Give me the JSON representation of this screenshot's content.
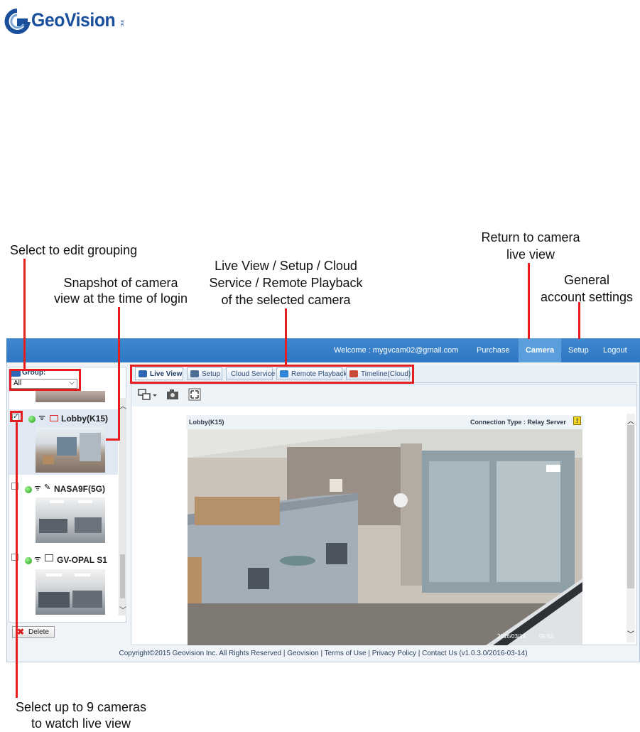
{
  "logo": {
    "text": "GeoVision",
    "suffix": "inc."
  },
  "annotations": {
    "grouping": "Select to edit grouping",
    "snapshot_l1": "Snapshot of camera",
    "snapshot_l2": "view at the time of login",
    "tabs_l1": "Live View / Setup / Cloud",
    "tabs_l2": "Service / Remote Playback",
    "tabs_l3": "of the selected camera",
    "camera_l1": "Return to camera",
    "camera_l2": "live view",
    "setup_l1": "General",
    "setup_l2": "account settings",
    "select_l1": "Select up to 9 cameras",
    "select_l2": "to watch live view"
  },
  "header": {
    "welcome": "Welcome : mygvcam02@gmail.com",
    "nav": [
      "Purchase",
      "Camera",
      "Setup",
      "Logout"
    ],
    "active": "Camera"
  },
  "sidebar": {
    "group_label": "Group:",
    "group_value": "All",
    "cameras": [
      {
        "name": "Lobby(K15)",
        "checked": true
      },
      {
        "name": "NASA9F(5G)",
        "checked": false
      },
      {
        "name": "GV-OPAL S1",
        "checked": false
      }
    ],
    "delete_label": "Delete"
  },
  "tabs": [
    "Live View",
    "Setup",
    "Cloud Service",
    "Remote Playback",
    "Timeline(Cloud)"
  ],
  "active_tab": "Live View",
  "viewer": {
    "camera_name": "Lobby(K15)",
    "connection": "Connection Type : Relay Server",
    "timestamp": "2016/03/14",
    "time": "05:53"
  },
  "footer": "Copyright©2015 Geovision Inc. All Rights Reserved | Geovision | Terms of Use | Privacy Policy | Contact Us (v1.0.3.0/2016-03-14)",
  "colors": {
    "accent": "#2f78c2",
    "annotation": "#e51f1f",
    "brand": "#1a4f9c"
  }
}
